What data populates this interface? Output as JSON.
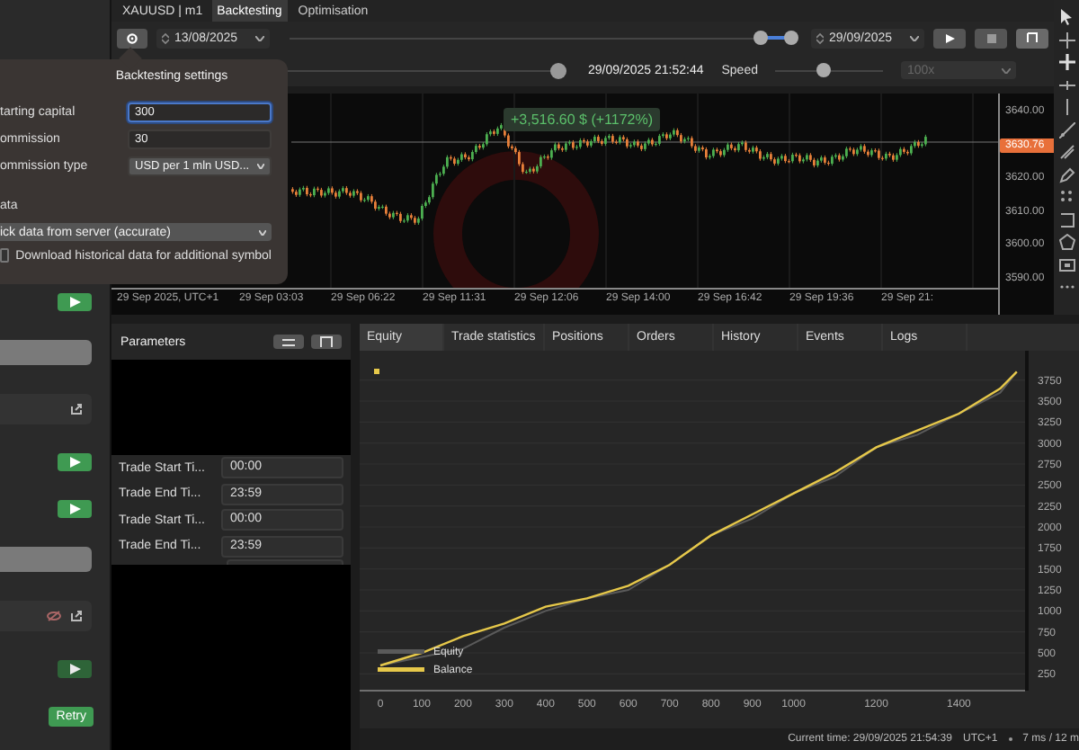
{
  "sidebar": {
    "items": [
      {
        "kind": "play",
        "disabled": false
      },
      {
        "kind": "bar"
      },
      {
        "kind": "export-row"
      },
      {
        "kind": "play",
        "disabled": false
      },
      {
        "kind": "play",
        "disabled": false
      },
      {
        "kind": "bar"
      },
      {
        "kind": "hidden-export-row"
      },
      {
        "kind": "play",
        "disabled": true
      },
      {
        "kind": "retry",
        "label": "Retry"
      }
    ]
  },
  "settings_popup": {
    "title": "Backtesting settings",
    "fields": [
      {
        "kind": "input",
        "label": "tarting capital",
        "value": "300",
        "focused": true
      },
      {
        "kind": "input",
        "label": "ommission",
        "value": "30",
        "focused": false
      },
      {
        "kind": "select",
        "label": "ommission type",
        "value": "USD per 1 mln USD...",
        "focused": false
      }
    ],
    "section": "ata",
    "data_source": "ick data from server (accurate)",
    "checkbox": {
      "label": "Download historical data for additional symbol",
      "checked": false
    }
  },
  "header": {
    "symbol": "XAUUSD | m1",
    "tabs": [
      {
        "label": "Backtesting",
        "selected": true
      },
      {
        "label": "Optimisation",
        "selected": false
      }
    ]
  },
  "toolbar": {
    "start_date": "13/08/2025",
    "range_start": {
      "level": 0.94
    },
    "range_end": {
      "level": 1.0
    },
    "end_date": "29/09/2025"
  },
  "playback": {
    "progress": {
      "level": 0.985
    },
    "current_time": "29/09/2025 21:52:44",
    "speed_label": "Speed",
    "speed": {
      "level": 0.45
    },
    "speed_value": "100x",
    "speed_disabled": true
  },
  "price_chart": {
    "profit_badge": "+3,516.60 $ (+1172%)",
    "price_labels": [
      "3640.00",
      "3620.00",
      "3610.00",
      "3600.00",
      "3590.00"
    ],
    "current_price": "3630.76",
    "time_labels": [
      "29 Sep 2025, UTC+1",
      "29 Sep 03:03",
      "29 Sep 06:22",
      "29 Sep 11:31",
      "29 Sep 12:06",
      "29 Sep 14:00",
      "29 Sep 16:42",
      "29 Sep 19:36",
      "29 Sep 21:"
    ]
  },
  "parameters": {
    "title": "Parameters",
    "rows": [
      {
        "label": "Trade Start Ti...",
        "value": "00:00"
      },
      {
        "label": "Trade End Ti...",
        "value": "23:59"
      },
      {
        "label": "Trade Start Ti...",
        "value": "00:00"
      },
      {
        "label": "Trade End Ti...",
        "value": "23:59"
      }
    ]
  },
  "results_tabs": [
    {
      "label": "Equity",
      "selected": true
    },
    {
      "label": "Trade statistics",
      "selected": false
    },
    {
      "label": "Positions",
      "selected": false
    },
    {
      "label": "Orders",
      "selected": false
    },
    {
      "label": "History",
      "selected": false
    },
    {
      "label": "Events",
      "selected": false
    },
    {
      "label": "Logs",
      "selected": false
    }
  ],
  "equity_chart": {
    "chart_data": {
      "type": "line",
      "x": [
        0,
        100,
        200,
        300,
        400,
        500,
        600,
        700,
        800,
        900,
        1000,
        1100,
        1200,
        1300,
        1400,
        1500,
        1540
      ],
      "series": [
        {
          "name": "Equity",
          "color": "#5a5a5a",
          "values": [
            350,
            450,
            550,
            800,
            1000,
            1150,
            1250,
            1550,
            1900,
            2100,
            2400,
            2600,
            2950,
            3100,
            3350,
            3600,
            3850
          ]
        },
        {
          "name": "Balance",
          "color": "#e6c84a",
          "values": [
            350,
            500,
            700,
            850,
            1050,
            1150,
            1300,
            1550,
            1900,
            2150,
            2400,
            2650,
            2950,
            3150,
            3350,
            3650,
            3850
          ]
        }
      ],
      "xlim": [
        -50,
        1560
      ],
      "ylim": [
        50,
        4100
      ],
      "grid": true,
      "legend": true,
      "xticks": [
        0,
        100,
        200,
        300,
        400,
        500,
        600,
        700,
        800,
        900,
        1000,
        1200,
        1400
      ],
      "yticks": [
        250,
        500,
        750,
        1000,
        1250,
        1500,
        1750,
        2000,
        2250,
        2500,
        2750,
        3000,
        3250,
        3500,
        3750
      ]
    }
  },
  "status_bar": {
    "current_time": "Current time: 29/09/2025 21:54:39",
    "timezone": "UTC+1",
    "latency": "7 ms / 12 m"
  }
}
